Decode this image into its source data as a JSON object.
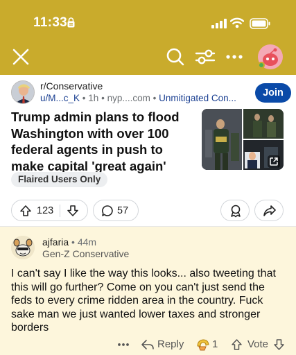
{
  "status_bar": {
    "time": "11:33"
  },
  "post": {
    "subreddit": "r/Conservative",
    "author": "u/M...c_K",
    "age": "1h",
    "domain": "nyp....com",
    "flair_tag": "Unmitigated Con...",
    "join_label": "Join",
    "title": "Trump admin plans to flood Washington with over 100 federal agents in push to make capital 'great again'",
    "flair": "Flaired Users Only",
    "upvotes": "123",
    "comments": "57"
  },
  "comment": {
    "username": "ajfaria",
    "age": "44m",
    "flair": "Gen-Z Conservative",
    "body": "I can't say I like the way this looks... also tweeting that this will go further? Come on you can't just send the feds to every crime ridden area in the country. Fuck sake man we just wanted lower taxes and stronger borders",
    "reply_label": "Reply",
    "award_count": "1",
    "vote_label": "Vote"
  },
  "colors": {
    "header": "#c9ab2c",
    "join": "#0a4aa8",
    "comment_bg": "#fdf6dc"
  },
  "icons": [
    "lock-icon",
    "signal-icon",
    "wifi-icon",
    "battery-icon",
    "close-icon",
    "search-icon",
    "filter-icon",
    "more-icon",
    "external-link-icon",
    "upvote-icon",
    "downvote-icon",
    "comment-icon",
    "award-icon",
    "share-icon",
    "reply-icon"
  ]
}
